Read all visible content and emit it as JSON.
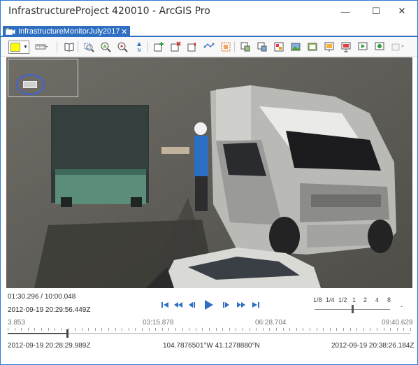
{
  "window": {
    "title": "InfrastructureProject 420010 - ArcGIS Pro",
    "minimize_glyph": "—",
    "maximize_glyph": "☐",
    "close_glyph": "✕"
  },
  "tab": {
    "label": "InfrastructureMonitorJuly2017",
    "close_glyph": "✕"
  },
  "toolbar": {
    "color_swatch": "#ffff00",
    "icons": [
      "color-picker-icon",
      "measure-icon",
      "bookmark-icon",
      "zoom-to-frame-icon",
      "zoom-to-footprint-icon",
      "zoom-to-center-icon",
      "north-up-icon",
      "add-feature-icon",
      "delete-feature-icon",
      "track-feature-icon",
      "capture-area-icon",
      "export-frame-icon",
      "export-footprint-icon",
      "export-center-icon",
      "create-image-icon",
      "create-video-icon",
      "capture-bookmark-icon",
      "create-frame-icon",
      "export-video-icon",
      "export-clip-icon",
      "more-options-icon"
    ]
  },
  "video": {
    "overview_indicator": "overview-map-icon"
  },
  "player": {
    "elapsed": "01:30.296 / 10:00.048",
    "current_datetime": "2012-09-19 20:29:56.449Z",
    "buttons": [
      {
        "name": "go-to-start-icon",
        "glyph": "⏮"
      },
      {
        "name": "fast-backward-icon",
        "glyph": "⏪"
      },
      {
        "name": "step-backward-icon",
        "glyph": "◀"
      },
      {
        "name": "play-icon",
        "glyph": "▶"
      },
      {
        "name": "step-forward-icon",
        "glyph": "▶"
      },
      {
        "name": "fast-forward-icon",
        "glyph": "⏩"
      },
      {
        "name": "go-to-end-icon",
        "glyph": "⏭"
      }
    ],
    "speed_labels": [
      "1/8",
      "1/4",
      "1/2",
      "1",
      "2",
      "4",
      "8"
    ],
    "speed_more": "-",
    "timeline_ticks": [
      "3.853",
      "03:15.878",
      "06:28.704",
      "09:40.629"
    ],
    "start_datetime": "2012-09-19 20:28:29.989Z",
    "coordinates": "104.7876501°W 41.1278880°N",
    "end_datetime": "2012-09-19 20:38:26.184Z"
  }
}
